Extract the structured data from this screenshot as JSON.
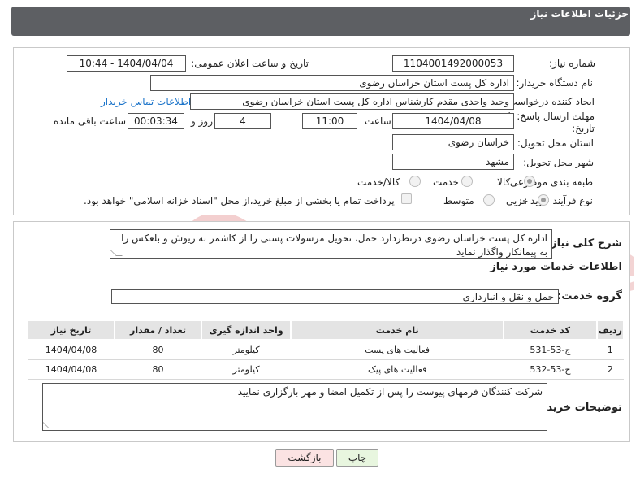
{
  "header": {
    "title": "جزئیات اطلاعات نیاز"
  },
  "form": {
    "need_number_label": "شماره نیاز:",
    "need_number": "1104001492000053",
    "announce_label": "تاریخ و ساعت اعلان عمومی:",
    "announce_value": "1404/04/04 - 10:44",
    "buyer_org_label": "نام دستگاه خریدار:",
    "buyer_org": "اداره کل پست استان خراسان رضوی",
    "creator_label": "ایجاد کننده درخواست:",
    "creator": "وحید واحدی مقدم کارشناس اداره کل پست استان خراسان رضوی",
    "contact_link": "اطلاعات تماس خریدار",
    "deadline_label_1": "مهلت ارسال پاسخ: تا",
    "deadline_label_2": "تاریخ:",
    "deadline_date": "1404/04/08",
    "time_label": "ساعت",
    "deadline_time": "11:00",
    "days_value": "4",
    "days_label": "روز و",
    "remaining_time": "00:03:34",
    "remaining_label": "ساعت باقی مانده",
    "province_label": "استان محل تحویل:",
    "province": "خراسان رضوی",
    "city_label": "شهر محل تحویل:",
    "city": "مشهد",
    "category_label": "طبقه بندی موضوعی:",
    "category_options": [
      "کالا",
      "خدمت",
      "کالا/خدمت"
    ],
    "process_label": "نوع فرآیند خرید :",
    "process_options": [
      "جزیی",
      "متوسط"
    ],
    "payment_note": "پرداخت تمام یا بخشی از مبلغ خرید،از محل \"اسناد خزانه اسلامی\" خواهد بود."
  },
  "description": {
    "label": "شرح کلی نیاز:",
    "text": "اداره کل پست خراسان رضوی درنظردارد حمل، تحویل مرسولات پستی را از کاشمر به ریوش و بلعکس را به پیمانکار واگذار نماید"
  },
  "services": {
    "section_title": "اطلاعات خدمات مورد نیاز",
    "group_label": "گروه خدمت:",
    "group_value": "حمل و نقل و انبارداری",
    "columns": [
      "ردیف",
      "کد خدمت",
      "نام خدمت",
      "واحد اندازه گیری",
      "تعداد / مقدار",
      "تاریخ نیاز"
    ],
    "rows": [
      [
        "1",
        "ج-53-531",
        "فعالیت های پست",
        "کیلومتر",
        "80",
        "1404/04/08"
      ],
      [
        "2",
        "ج-53-532",
        "فعالیت های پیک",
        "کیلومتر",
        "80",
        "1404/04/08"
      ]
    ]
  },
  "buyer_notes": {
    "label": "توضیحات خریدار:",
    "text": "شرکت کنندگان فرمهای پیوست را پس از تکمیل امضا و مهر بارگزاری نمایید"
  },
  "buttons": {
    "print": "چاپ",
    "back": "بازگشت"
  },
  "watermark": {
    "text": "AriaTender.neT"
  },
  "colors": {
    "header_bg": "#5d5f63",
    "link": "#1a73c9",
    "print_bg": "#e8f6df",
    "back_bg": "#fbe3e3",
    "watermark": "#f2c8c8"
  }
}
